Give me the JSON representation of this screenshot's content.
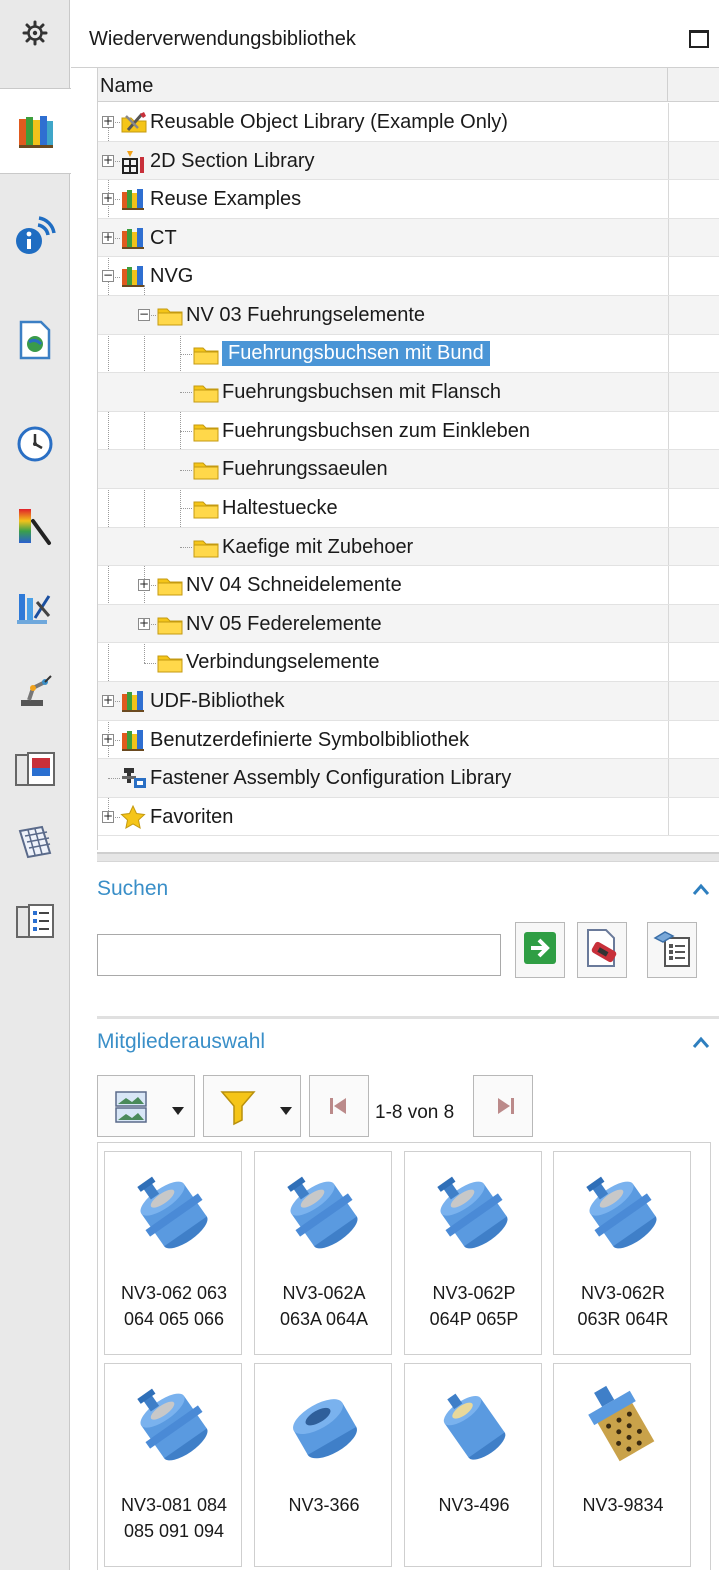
{
  "panel": {
    "title": "Wiederverwendungsbibliothek"
  },
  "rail": {
    "items": [
      {
        "icon": "gear-icon"
      },
      {
        "icon": "reuse-library-icon",
        "active": true
      },
      {
        "icon": "info-broadcast-icon"
      },
      {
        "icon": "web-document-icon"
      },
      {
        "icon": "history-clock-icon"
      },
      {
        "icon": "system-materials-icon"
      },
      {
        "icon": "process-studio-icon"
      },
      {
        "icon": "robot-arm-icon"
      },
      {
        "icon": "visual-report-icon"
      },
      {
        "icon": "table-grid-icon"
      },
      {
        "icon": "roles-list-icon"
      }
    ]
  },
  "tree": {
    "column_header": "Name",
    "nodes": [
      {
        "label": "Reusable Object Library (Example Only)",
        "icon": "tools-folder-icon",
        "expander": "+",
        "depth": 0
      },
      {
        "label": "2D Section Library",
        "icon": "section-library-icon",
        "expander": "+",
        "depth": 0
      },
      {
        "label": "Reuse Examples",
        "icon": "books-icon",
        "expander": "+",
        "depth": 0
      },
      {
        "label": "CT",
        "icon": "books-icon",
        "expander": "+",
        "depth": 0
      },
      {
        "label": "NVG",
        "icon": "books-icon",
        "expander": "−",
        "depth": 0
      },
      {
        "label": "NV 03 Fuehrungselemente",
        "icon": "folder-icon",
        "expander": "−",
        "depth": 1
      },
      {
        "label": "Fuehrungsbuchsen mit Bund",
        "icon": "folder-icon",
        "expander": "",
        "depth": 2,
        "selected": true
      },
      {
        "label": "Fuehrungsbuchsen mit Flansch",
        "icon": "folder-icon",
        "expander": "",
        "depth": 2
      },
      {
        "label": "Fuehrungsbuchsen zum Einkleben",
        "icon": "folder-icon",
        "expander": "",
        "depth": 2
      },
      {
        "label": "Fuehrungssaeulen",
        "icon": "folder-icon",
        "expander": "",
        "depth": 2
      },
      {
        "label": "Haltestuecke",
        "icon": "folder-icon",
        "expander": "",
        "depth": 2
      },
      {
        "label": "Kaefige mit Zubehoer",
        "icon": "folder-icon",
        "expander": "",
        "depth": 2
      },
      {
        "label": "NV 04 Schneidelemente",
        "icon": "folder-icon",
        "expander": "+",
        "depth": 1
      },
      {
        "label": "NV 05 Federelemente",
        "icon": "folder-icon",
        "expander": "+",
        "depth": 1
      },
      {
        "label": "Verbindungselemente",
        "icon": "folder-icon",
        "expander": "",
        "depth": 1
      },
      {
        "label": "UDF-Bibliothek",
        "icon": "books-icon",
        "expander": "+",
        "depth": 0
      },
      {
        "label": "Benutzerdefinierte Symbolbibliothek",
        "icon": "books-icon",
        "expander": "+",
        "depth": 0
      },
      {
        "label": "Fastener Assembly Configuration Library",
        "icon": "fastener-config-icon",
        "expander": "",
        "depth": 0
      },
      {
        "label": "Favoriten",
        "icon": "star-icon",
        "expander": "+",
        "depth": 0
      }
    ]
  },
  "search": {
    "title": "Suchen",
    "input_value": "",
    "input_placeholder": "",
    "buttons": [
      "go-arrow-icon",
      "search-document-icon",
      "search-options-icon"
    ]
  },
  "members": {
    "title": "Mitgliederauswahl",
    "pager": "1-8 von 8",
    "items": [
      {
        "label": "NV3-062 063\n064 065 066",
        "thumb": "flanged-bushing-icon"
      },
      {
        "label": "NV3-062A\n063A 064A",
        "thumb": "flanged-bushing-icon"
      },
      {
        "label": "NV3-062P\n064P 065P",
        "thumb": "flanged-bushing-icon"
      },
      {
        "label": "NV3-062R\n063R 064R",
        "thumb": "flanged-bushing-icon"
      },
      {
        "label": "NV3-081 084\n085 091 094",
        "thumb": "flanged-bushing-icon"
      },
      {
        "label": "NV3-366",
        "thumb": "plain-bushing-icon"
      },
      {
        "label": "NV3-496",
        "thumb": "clamped-bushing-icon"
      },
      {
        "label": "NV3-9834",
        "thumb": "bronze-bushing-icon"
      }
    ]
  },
  "colors": {
    "accent": "#3a8fc8",
    "selection": "#4a95d6",
    "folder": "#f5c518",
    "part": "#4f8fd8"
  }
}
